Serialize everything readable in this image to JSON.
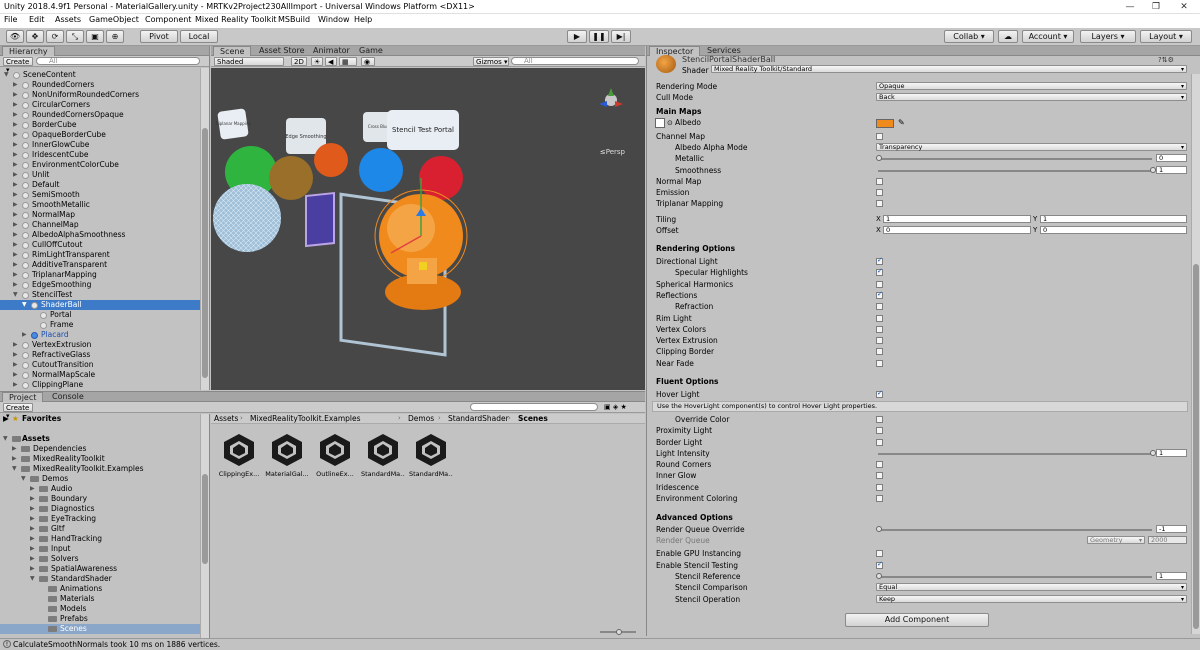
{
  "window": {
    "title": "Unity 2018.4.9f1 Personal - MaterialGallery.unity - MRTKv2Project230AllImport - Universal Windows Platform <DX11>"
  },
  "menu": [
    "File",
    "Edit",
    "Assets",
    "GameObject",
    "Component",
    "Mixed Reality Toolkit",
    "MSBuild",
    "Window",
    "Help"
  ],
  "toolbar": {
    "pivot": "Pivot",
    "local": "Local",
    "collab": "Collab ▾",
    "account": "Account",
    "layers": "Layers",
    "layout": "Layout"
  },
  "hierarchy": {
    "tab": "Hierarchy",
    "create": "Create ▾",
    "search_placeholder": "All",
    "items": [
      {
        "label": "SceneContent",
        "depth": 1,
        "open": true
      },
      {
        "label": "RoundedCorners",
        "depth": 2
      },
      {
        "label": "NonUniformRoundedCorners",
        "depth": 2
      },
      {
        "label": "CircularCorners",
        "depth": 2
      },
      {
        "label": "RoundedCornersOpaque",
        "depth": 2
      },
      {
        "label": "BorderCube",
        "depth": 2
      },
      {
        "label": "OpaqueBorderCube",
        "depth": 2
      },
      {
        "label": "InnerGlowCube",
        "depth": 2
      },
      {
        "label": "IridescentCube",
        "depth": 2
      },
      {
        "label": "EnvironmentColorCube",
        "depth": 2
      },
      {
        "label": "Unlit",
        "depth": 2
      },
      {
        "label": "Default",
        "depth": 2
      },
      {
        "label": "SemiSmooth",
        "depth": 2
      },
      {
        "label": "SmoothMetallic",
        "depth": 2
      },
      {
        "label": "NormalMap",
        "depth": 2
      },
      {
        "label": "ChannelMap",
        "depth": 2
      },
      {
        "label": "AlbedoAlphaSmoothness",
        "depth": 2
      },
      {
        "label": "CullOffCutout",
        "depth": 2
      },
      {
        "label": "RimLightTransparent",
        "depth": 2
      },
      {
        "label": "AdditiveTransparent",
        "depth": 2
      },
      {
        "label": "TriplanarMapping",
        "depth": 2
      },
      {
        "label": "EdgeSmoothing",
        "depth": 2
      },
      {
        "label": "StencilTest",
        "depth": 2,
        "open": true
      },
      {
        "label": "ShaderBall",
        "depth": 3,
        "open": true,
        "selected": true
      },
      {
        "label": "Portal",
        "depth": 4
      },
      {
        "label": "Frame",
        "depth": 4
      },
      {
        "label": "Placard",
        "depth": 3,
        "blue": true
      },
      {
        "label": "VertexExtrusion",
        "depth": 2
      },
      {
        "label": "RefractiveGlass",
        "depth": 2
      },
      {
        "label": "CutoutTransition",
        "depth": 2
      },
      {
        "label": "NormalMapScale",
        "depth": 2
      },
      {
        "label": "ClippingPlane",
        "depth": 2
      }
    ]
  },
  "scene": {
    "tabs": [
      "Scene",
      "Asset Store",
      "Animator",
      "Game"
    ],
    "shading": "Shaded",
    "mode2d": "2D",
    "gizmos": "Gizmos ▾",
    "search_placeholder": "All",
    "persp": "≤Persp",
    "labels": {
      "stencil": "Stencil Test Portal",
      "edge": "Edge Smoothing",
      "triplanar": "Triplanar Mapping",
      "cross": "Cross Blur"
    }
  },
  "project": {
    "tabs": [
      "Project",
      "Console"
    ],
    "create": "Create ▾",
    "favorites": "Favorites",
    "assets": "Assets",
    "tree": [
      {
        "label": "Dependencies",
        "depth": 1
      },
      {
        "label": "MixedRealityToolkit",
        "depth": 1
      },
      {
        "label": "MixedRealityToolkit.Examples",
        "depth": 1,
        "open": true
      },
      {
        "label": "Demos",
        "depth": 2,
        "open": true
      },
      {
        "label": "Audio",
        "depth": 3
      },
      {
        "label": "Boundary",
        "depth": 3
      },
      {
        "label": "Diagnostics",
        "depth": 3
      },
      {
        "label": "EyeTracking",
        "depth": 3
      },
      {
        "label": "Gltf",
        "depth": 3
      },
      {
        "label": "HandTracking",
        "depth": 3
      },
      {
        "label": "Input",
        "depth": 3
      },
      {
        "label": "Solvers",
        "depth": 3
      },
      {
        "label": "SpatialAwareness",
        "depth": 3
      },
      {
        "label": "StandardShader",
        "depth": 3,
        "open": true
      },
      {
        "label": "Animations",
        "depth": 4
      },
      {
        "label": "Materials",
        "depth": 4
      },
      {
        "label": "Models",
        "depth": 4
      },
      {
        "label": "Prefabs",
        "depth": 4
      },
      {
        "label": "Scenes",
        "depth": 4,
        "selected": true
      }
    ],
    "breadcrumb": [
      "Assets",
      "MixedRealityToolkit.Examples",
      "Demos",
      "StandardShader",
      "Scenes"
    ],
    "files": [
      "ClippingEx...",
      "MaterialGal...",
      "OutlineEx...",
      "StandardMa...",
      "StandardMa..."
    ]
  },
  "status": "CalculateSmoothNormals took 10 ms on 1886 vertices.",
  "inspector": {
    "tabs": [
      "Inspector",
      "Services"
    ],
    "object_name": "StencilPortalShaderBall",
    "shader_label": "Shader",
    "shader_value": "Mixed Reality Toolkit/Standard",
    "rendering_mode": {
      "label": "Rendering Mode",
      "value": "Opaque"
    },
    "cull_mode": {
      "label": "Cull Mode",
      "value": "Back"
    },
    "main_maps": "Main Maps",
    "albedo": "Albedo",
    "albedo_color": "#f08a1c",
    "channel_map": "Channel Map",
    "albedo_alpha_mode": {
      "label": "Albedo Alpha Mode",
      "value": "Transparency"
    },
    "metallic": {
      "label": "Metallic",
      "value": "0",
      "fraction": 0
    },
    "smoothness": {
      "label": "Smoothness",
      "value": "1",
      "fraction": 1
    },
    "normal_map": "Normal Map",
    "emission": "Emission",
    "triplanar": "Triplanar Mapping",
    "tiling": {
      "label": "Tiling",
      "x": "1",
      "y": "1"
    },
    "offset": {
      "label": "Offset",
      "x": "0",
      "y": "0"
    },
    "x_label": "X",
    "y_label": "Y",
    "rendering_options": "Rendering Options",
    "ro_items": [
      {
        "label": "Directional Light",
        "on": true,
        "indent": false
      },
      {
        "label": "Specular Highlights",
        "on": true,
        "indent": true
      },
      {
        "label": "Spherical Harmonics",
        "on": false,
        "indent": false
      },
      {
        "label": "Reflections",
        "on": true,
        "indent": false
      },
      {
        "label": "Refraction",
        "on": false,
        "indent": true
      },
      {
        "label": "Rim Light",
        "on": false,
        "indent": false
      },
      {
        "label": "Vertex Colors",
        "on": false,
        "indent": false
      },
      {
        "label": "Vertex Extrusion",
        "on": false,
        "indent": false
      },
      {
        "label": "Clipping Border",
        "on": false,
        "indent": false
      },
      {
        "label": "Near Fade",
        "on": false,
        "indent": false
      }
    ],
    "fluent_options": "Fluent Options",
    "hover_light": "Hover Light",
    "hover_help": "Use the HoverLight component(s) to control Hover Light properties.",
    "fo_items": [
      {
        "label": "Override Color",
        "on": false,
        "indent": true
      },
      {
        "label": "Proximity Light",
        "on": false,
        "indent": false
      },
      {
        "label": "Border Light",
        "on": false,
        "indent": false
      }
    ],
    "light_intensity": {
      "label": "Light Intensity",
      "value": "1",
      "fraction": 1
    },
    "fo_items2": [
      {
        "label": "Round Corners",
        "on": false
      },
      {
        "label": "Inner Glow",
        "on": false
      },
      {
        "label": "Iridescence",
        "on": false
      },
      {
        "label": "Environment Coloring",
        "on": false
      }
    ],
    "advanced_options": "Advanced Options",
    "render_queue_override": {
      "label": "Render Queue Override",
      "value": "-1",
      "fraction": 0
    },
    "render_queue": {
      "label": "Render Queue",
      "dropdown": "Geometry",
      "value": "2000"
    },
    "gpu_instancing": {
      "label": "Enable GPU Instancing",
      "on": false
    },
    "stencil_testing": {
      "label": "Enable Stencil Testing",
      "on": true
    },
    "stencil_reference": {
      "label": "Stencil Reference",
      "value": "1",
      "fraction": 0
    },
    "stencil_comparison": {
      "label": "Stencil Comparison",
      "value": "Equal"
    },
    "stencil_operation": {
      "label": "Stencil Operation",
      "value": "Keep"
    },
    "add_component": "Add Component"
  }
}
